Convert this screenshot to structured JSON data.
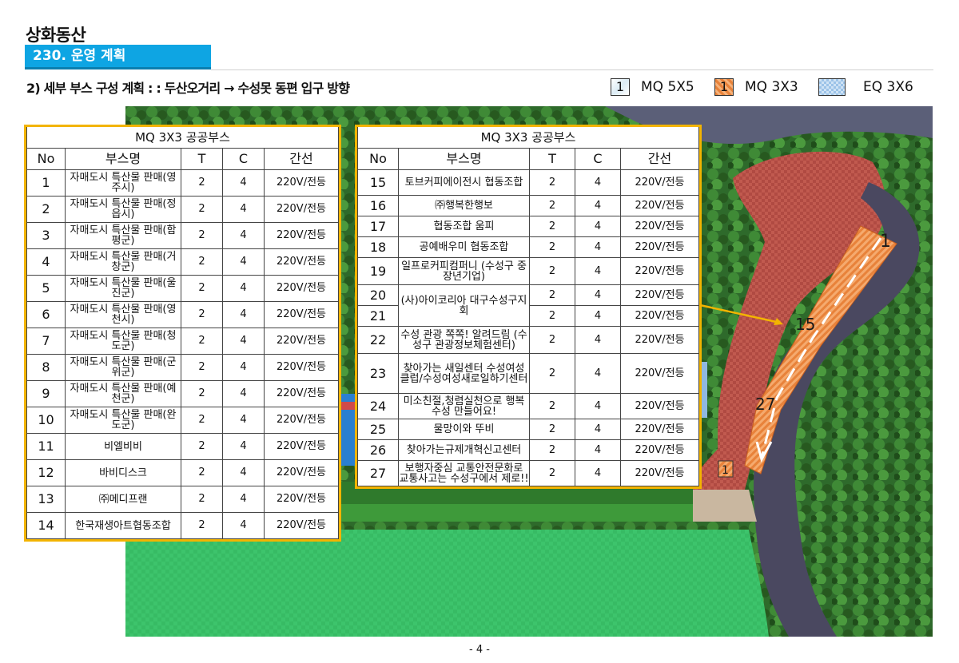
{
  "header": {
    "title": "상화동산",
    "section": "230. 운영 계획",
    "subtitle": "2) 세부 부스 구성 계획 : : 두산오거리 → 수성못 동편 입구 방향"
  },
  "legend": [
    {
      "mark": "1",
      "label": "MQ 5X5",
      "icon": "mq-5x5-swatch"
    },
    {
      "mark": "1",
      "label": "MQ 3X3",
      "icon": "mq-3x3-swatch"
    },
    {
      "mark": "",
      "label": "EQ 3X6",
      "icon": "eq-3x6-swatch"
    }
  ],
  "colors": {
    "accent": "#0ea5e3",
    "table_border": "#f3b400",
    "booth_zone": "#e8823a",
    "plaza": "#c0574e",
    "road": "#4a4860",
    "lawn": "#3cc26a"
  },
  "table_left": {
    "caption": "MQ 3X3 공공부스",
    "columns": [
      "No",
      "부스명",
      "T",
      "C",
      "간선"
    ],
    "rows": [
      {
        "no": "1",
        "name": "자매도시 특산물 판매(영주시)",
        "t": "2",
        "c": "4",
        "power": "220V/전등"
      },
      {
        "no": "2",
        "name": "자매도시 특산물 판매(정읍시)",
        "t": "2",
        "c": "4",
        "power": "220V/전등"
      },
      {
        "no": "3",
        "name": "자매도시 특산물 판매(함평군)",
        "t": "2",
        "c": "4",
        "power": "220V/전등"
      },
      {
        "no": "4",
        "name": "자매도시 특산물 판매(거창군)",
        "t": "2",
        "c": "4",
        "power": "220V/전등"
      },
      {
        "no": "5",
        "name": "자매도시 특산물 판매(울진군)",
        "t": "2",
        "c": "4",
        "power": "220V/전등"
      },
      {
        "no": "6",
        "name": "자매도시 특산물 판매(영천시)",
        "t": "2",
        "c": "4",
        "power": "220V/전등"
      },
      {
        "no": "7",
        "name": "자매도시 특산물 판매(청도군)",
        "t": "2",
        "c": "4",
        "power": "220V/전등"
      },
      {
        "no": "8",
        "name": "자매도시 특산물 판매(군위군)",
        "t": "2",
        "c": "4",
        "power": "220V/전등"
      },
      {
        "no": "9",
        "name": "자매도시 특산물 판매(예천군)",
        "t": "2",
        "c": "4",
        "power": "220V/전등"
      },
      {
        "no": "10",
        "name": "자매도시 특산물 판매(완도군)",
        "t": "2",
        "c": "4",
        "power": "220V/전등"
      },
      {
        "no": "11",
        "name": "비엘비비",
        "t": "2",
        "c": "4",
        "power": "220V/전등"
      },
      {
        "no": "12",
        "name": "바비디스크",
        "t": "2",
        "c": "4",
        "power": "220V/전등"
      },
      {
        "no": "13",
        "name": "㈜메디프랜",
        "t": "2",
        "c": "4",
        "power": "220V/전등"
      },
      {
        "no": "14",
        "name": "한국재생아트협동조합",
        "t": "2",
        "c": "4",
        "power": "220V/전등"
      }
    ]
  },
  "table_right": {
    "caption": "MQ 3X3 공공부스",
    "columns": [
      "No",
      "부스명",
      "T",
      "C",
      "간선"
    ],
    "rows": [
      {
        "no": "15",
        "name": "토브커피에이전시 협동조합",
        "t": "2",
        "c": "4",
        "power": "220V/전등"
      },
      {
        "no": "16",
        "name": "㈜행복한행보",
        "t": "2",
        "c": "4",
        "power": "220V/전등"
      },
      {
        "no": "17",
        "name": "협동조합 움피",
        "t": "2",
        "c": "4",
        "power": "220V/전등"
      },
      {
        "no": "18",
        "name": "공예배우미 협동조합",
        "t": "2",
        "c": "4",
        "power": "220V/전등"
      },
      {
        "no": "19",
        "name": "일프로커피컴퍼니 (수성구 중장년기업)",
        "t": "2",
        "c": "4",
        "power": "220V/전등"
      },
      {
        "no": "20",
        "name": "(사)아이코리아 대구수성구지회",
        "t": "2",
        "c": "4",
        "power": "220V/전등"
      },
      {
        "no": "21",
        "name": "",
        "t": "2",
        "c": "4",
        "power": "220V/전등"
      },
      {
        "no": "22",
        "name": "수성 관광 쪽쪽! 알려드림 (수성구 관광정보체험센터)",
        "t": "2",
        "c": "4",
        "power": "220V/전등"
      },
      {
        "no": "23",
        "name": "찾아가는 새일센터 수성여성클럽/수성여성새로일하기센터",
        "t": "2",
        "c": "4",
        "power": "220V/전등"
      },
      {
        "no": "24",
        "name": "미소친절,청렴실천으로 행복수성 만들어요!",
        "t": "2",
        "c": "4",
        "power": "220V/전등"
      },
      {
        "no": "25",
        "name": "물망이와 뚜비",
        "t": "2",
        "c": "4",
        "power": "220V/전등"
      },
      {
        "no": "26",
        "name": "찾아가는규제개혁신고센터",
        "t": "2",
        "c": "4",
        "power": "220V/전등"
      },
      {
        "no": "27",
        "name": "보행자중심 교통안전문화로 교통사고는 수성구에서 제로!!",
        "t": "2",
        "c": "4",
        "power": "220V/전등"
      }
    ]
  },
  "map": {
    "labels": {
      "start": "1",
      "middle": "15",
      "end": "27",
      "entrance": "1"
    }
  },
  "footer": {
    "page": "- 4 -"
  }
}
